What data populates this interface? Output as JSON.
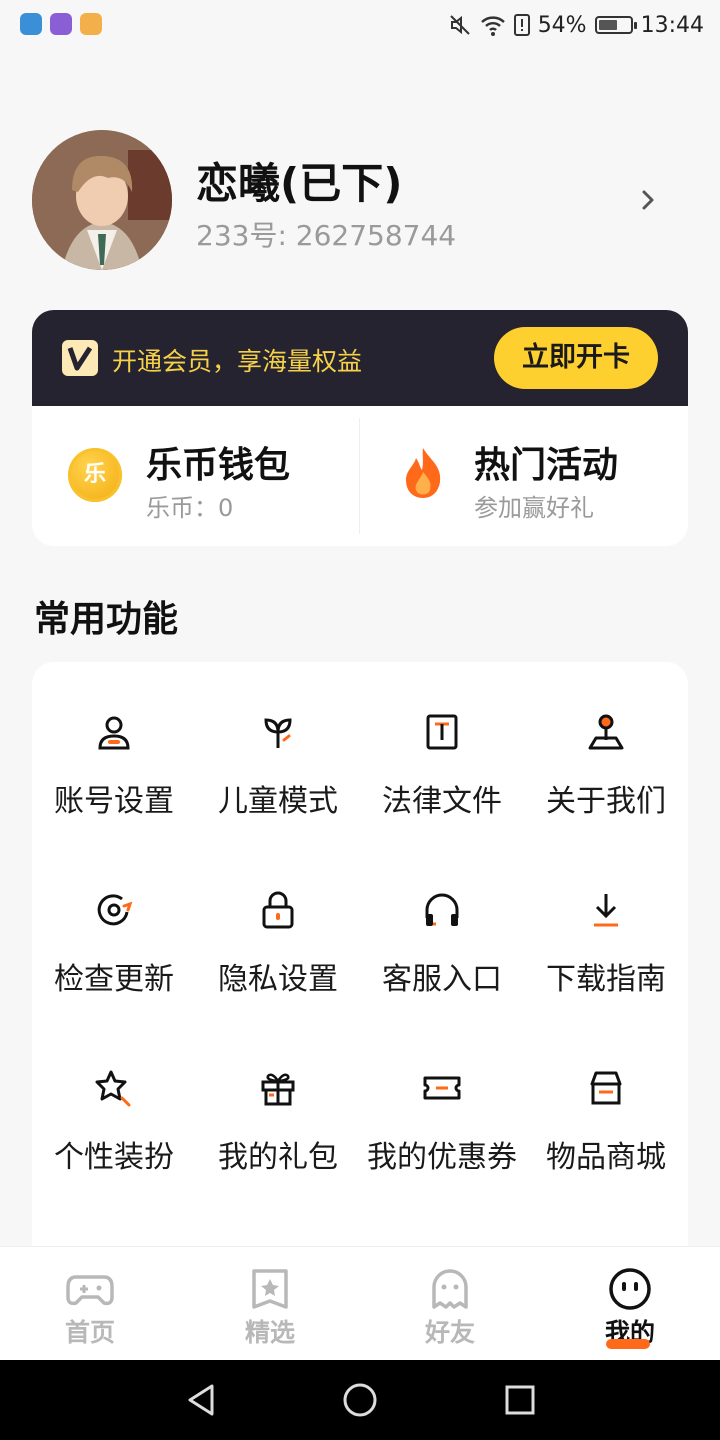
{
  "status_bar": {
    "app_icons": [
      {
        "name": "shield-app-icon",
        "color": "#3a8fd6"
      },
      {
        "name": "clock-app-icon",
        "color": "#8a5fd6"
      },
      {
        "name": "box-app-icon",
        "color": "#f3b04a"
      }
    ],
    "battery": "54%",
    "time": "13:44"
  },
  "profile": {
    "name": "恋曦(已下)",
    "id_text": "233号: 262758744"
  },
  "vip": {
    "text": "开通会员，享海量权益",
    "button": "立即开卡"
  },
  "wallet": {
    "title": "乐币钱包",
    "sub": "乐币：0",
    "coin_char": "乐"
  },
  "activity": {
    "title": "热门活动",
    "sub": "参加赢好礼"
  },
  "section_title": "常用功能",
  "functions": [
    {
      "label": "账号设置",
      "icon": "user-icon"
    },
    {
      "label": "儿童模式",
      "icon": "sprout-icon"
    },
    {
      "label": "法律文件",
      "icon": "document-icon"
    },
    {
      "label": "关于我们",
      "icon": "location-pin-icon"
    },
    {
      "label": "检查更新",
      "icon": "refresh-icon"
    },
    {
      "label": "隐私设置",
      "icon": "lock-icon"
    },
    {
      "label": "客服入口",
      "icon": "headphones-icon"
    },
    {
      "label": "下载指南",
      "icon": "download-icon"
    },
    {
      "label": "个性装扮",
      "icon": "star-wand-icon"
    },
    {
      "label": "我的礼包",
      "icon": "gift-icon"
    },
    {
      "label": "我的优惠券",
      "icon": "ticket-icon"
    },
    {
      "label": "物品商城",
      "icon": "store-icon"
    }
  ],
  "bottom_nav": [
    {
      "label": "首页",
      "icon": "gamepad-icon",
      "active": false
    },
    {
      "label": "精选",
      "icon": "star-card-icon",
      "active": false
    },
    {
      "label": "好友",
      "icon": "ghost-icon",
      "active": false
    },
    {
      "label": "我的",
      "icon": "smiley-icon",
      "active": true
    }
  ],
  "colors": {
    "accent_orange": "#ff6a1a",
    "vip_yellow": "#fdd030",
    "vip_dark": "#25232f"
  }
}
